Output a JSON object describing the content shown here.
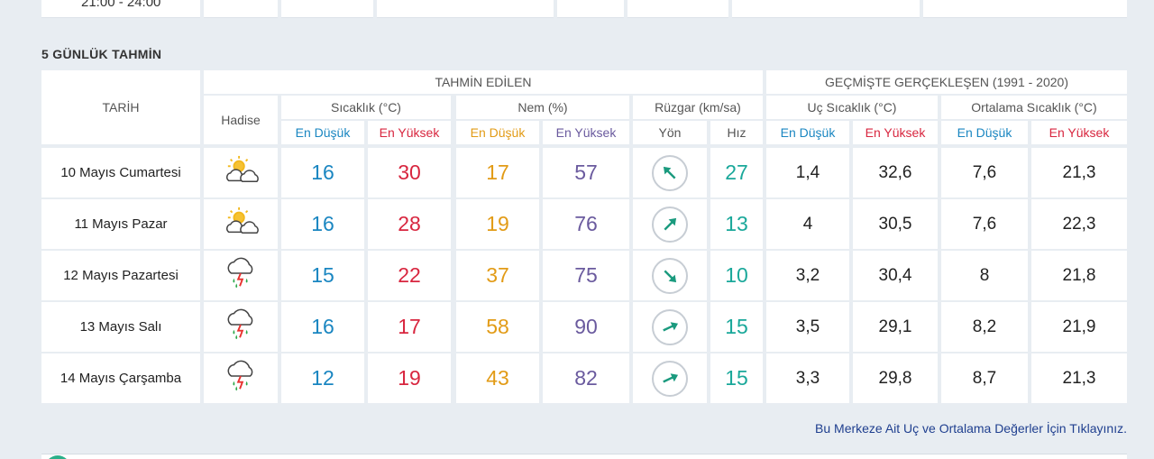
{
  "top_row": {
    "time_range": "21:00 - 24:00"
  },
  "section": {
    "title": "5 GÜNLÜK TAHMİN"
  },
  "headers": {
    "date": "TARİH",
    "event": "Hadise",
    "predicted_group": "TAHMİN EDİLEN",
    "historical_group": "GEÇMİŞTE GERÇEKLEŞEN (1991 - 2020)",
    "temp": "Sıcaklık (°C)",
    "humidity": "Nem (%)",
    "wind": "Rüzgar (km/sa)",
    "extreme_temp": "Uç Sıcaklık (°C)",
    "avg_temp": "Ortalama Sıcaklık (°C)",
    "low": "En Düşük",
    "high": "En Yüksek",
    "direction": "Yön",
    "speed": "Hız"
  },
  "days": [
    {
      "date": "10 Mayıs Cumartesi",
      "icon": "partly-sunny-icon",
      "temp_low": "16",
      "temp_high": "30",
      "hum_low": "17",
      "hum_high": "57",
      "wind_dir": "northeast",
      "wind_speed": "27",
      "ext_low": "1,4",
      "ext_high": "32,6",
      "avg_low": "7,6",
      "avg_high": "21,3"
    },
    {
      "date": "11 Mayıs Pazar",
      "icon": "partly-sunny-icon",
      "temp_low": "16",
      "temp_high": "28",
      "hum_low": "19",
      "hum_high": "76",
      "wind_dir": "southeast",
      "wind_speed": "13",
      "ext_low": "4",
      "ext_high": "30,5",
      "avg_low": "7,6",
      "avg_high": "22,3"
    },
    {
      "date": "12 Mayıs Pazartesi",
      "icon": "thunderstorm-icon",
      "temp_low": "15",
      "temp_high": "22",
      "hum_low": "37",
      "hum_high": "75",
      "wind_dir": "southwest",
      "wind_speed": "10",
      "ext_low": "3,2",
      "ext_high": "30,4",
      "avg_low": "8",
      "avg_high": "21,8"
    },
    {
      "date": "13 Mayıs Salı",
      "icon": "thunderstorm-icon",
      "temp_low": "16",
      "temp_high": "17",
      "hum_low": "58",
      "hum_high": "90",
      "wind_dir": "south-southeast",
      "wind_speed": "15",
      "ext_low": "3,5",
      "ext_high": "29,1",
      "avg_low": "8,2",
      "avg_high": "21,9"
    },
    {
      "date": "14 Mayıs Çarşamba",
      "icon": "thunderstorm-icon",
      "temp_low": "12",
      "temp_high": "19",
      "hum_low": "43",
      "hum_high": "82",
      "wind_dir": "south-southeast",
      "wind_speed": "15",
      "ext_low": "3,3",
      "ext_high": "29,8",
      "avg_low": "8,7",
      "avg_high": "21,3"
    }
  ],
  "footer": {
    "link": "Bu Merkeze Ait Uç ve Ortalama Değerler İçin Tıklayınız."
  },
  "colors": {
    "low_temp": "#1a86c1",
    "high_temp": "#d8263f",
    "low_hum": "#e29b16",
    "high_hum": "#6a5a9e",
    "wind": "#1aa89a",
    "background": "#e8edf2"
  }
}
